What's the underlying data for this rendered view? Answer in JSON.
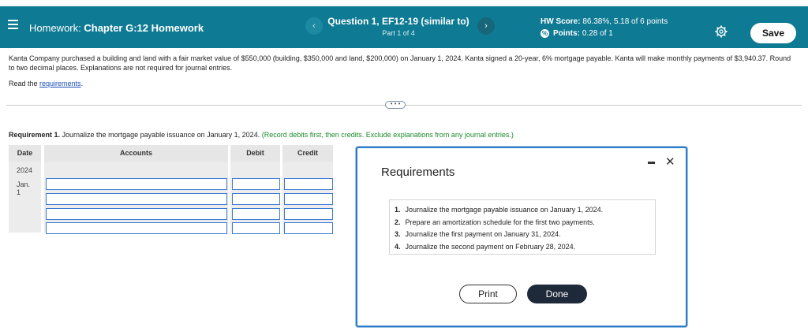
{
  "header": {
    "course_prefix": "Homework:",
    "course_title": "Chapter G:12 Homework",
    "question_title": "Question 1, EF12-19 (similar to)",
    "question_part": "Part 1 of 4",
    "prev_label": "‹",
    "next_label": "›",
    "hw_score_label": "HW Score:",
    "hw_score_value": "86.38%, 5.18 of 6 points",
    "points_label": "Points:",
    "points_value": "0.28 of 1",
    "save_label": "Save"
  },
  "problem": {
    "text": "Kanta Company purchased a building and land with a fair market value of $550,000 (building, $350,000 and land, $200,000) on January 1, 2024. Kanta signed a 20-year, 6% mortgage payable. Kanta will make monthly payments of $3,940.37. Round to two decimal places. Explanations are not required for journal entries.",
    "read_prefix": "Read the ",
    "read_link": "requirements",
    "read_suffix": "."
  },
  "more_label": "• • •",
  "requirement": {
    "label": "Requirement 1.",
    "text": " Journalize the mortgage payable issuance on January 1, 2024. ",
    "hint": "(Record debits first, then credits. Exclude explanations from any journal entries.)"
  },
  "journal": {
    "headers": {
      "date": "Date",
      "accounts": "Accounts",
      "debit": "Debit",
      "credit": "Credit"
    },
    "year": "2024",
    "date": "Jan. 1"
  },
  "modal": {
    "title": "Requirements",
    "items": [
      {
        "num": "1.",
        "text": "Journalize the mortgage payable issuance on January 1, 2024."
      },
      {
        "num": "2.",
        "text": "Prepare an amortization schedule for the first two payments."
      },
      {
        "num": "3.",
        "text": "Journalize the first payment on January 31, 2024."
      },
      {
        "num": "4.",
        "text": "Journalize the second payment on February 28, 2024."
      }
    ],
    "print_label": "Print",
    "done_label": "Done",
    "close_label": "✕"
  },
  "colors": {
    "header_bg": "#0f7a93",
    "input_border": "#3a7bd5",
    "hint": "#1a8a2a",
    "done_bg": "#1e2a3a"
  }
}
